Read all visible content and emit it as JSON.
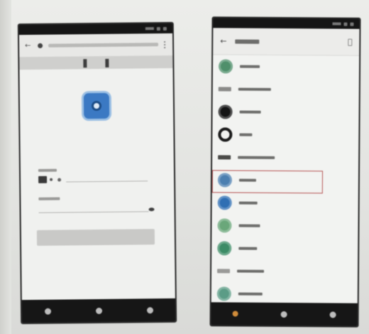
{
  "colors": {
    "background": "#e6e7e4",
    "phone_frame": "#2a2a2a",
    "logo_blue": "#3b79c3",
    "highlight_red": "#b55252",
    "nav_back_accent": "#d08c3a"
  },
  "left_phone": {
    "browser": {
      "back_icon": "back-arrow-icon",
      "lock_icon": "lock-icon",
      "url": "",
      "menu_icon": "overflow-menu-icon"
    },
    "login": {
      "logo_icon": "app-logo-icon",
      "region_label": "",
      "phone_placeholder": "",
      "password_label": "",
      "password_placeholder": "",
      "signin_label": ""
    },
    "nav": [
      "back",
      "home",
      "recents"
    ]
  },
  "right_phone": {
    "appbar": {
      "back_icon": "back-arrow-icon",
      "title": "",
      "action_icon": "scan-icon"
    },
    "devices": [
      {
        "name": "",
        "icon_color": "#4f8f6b",
        "shape": "round"
      },
      {
        "name": "",
        "icon_color": "#8a8a88",
        "shape": "wide"
      },
      {
        "name": "",
        "icon_color": "#141414",
        "shape": "round"
      },
      {
        "name": "",
        "icon_color": "#1b1b1b",
        "shape": "ring"
      },
      {
        "name": "",
        "icon_color": "#4a4a48",
        "shape": "wide"
      },
      {
        "name": "",
        "icon_color": "#4c7fb0",
        "shape": "round",
        "highlighted": true
      },
      {
        "name": "",
        "icon_color": "#2f6fb3",
        "shape": "round"
      },
      {
        "name": "",
        "icon_color": "#6aa77a",
        "shape": "round"
      },
      {
        "name": "",
        "icon_color": "#3c8c66",
        "shape": "round"
      },
      {
        "name": "",
        "icon_color": "#9a9a98",
        "shape": "wide"
      },
      {
        "name": "",
        "icon_color": "#5b9c86",
        "shape": "round"
      }
    ],
    "nav": [
      "back",
      "home",
      "recents"
    ]
  }
}
